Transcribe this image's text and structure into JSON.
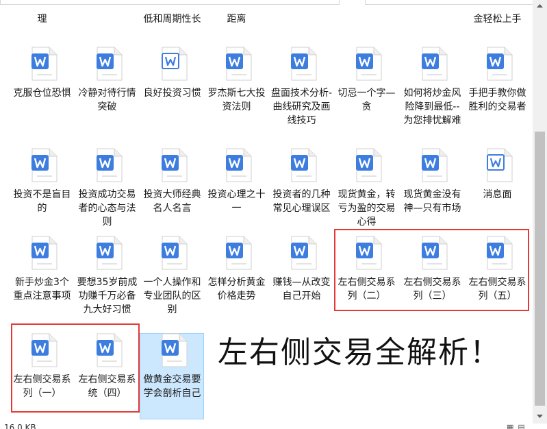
{
  "partial_top_labels": [
    "理",
    "低和周期性长",
    "距离",
    "金轻松上手"
  ],
  "files": [
    {
      "label": "克服仓位恐惧",
      "icon": "word-doc-icon"
    },
    {
      "label": "冷静对待行情突破",
      "icon": "word-doc-icon"
    },
    {
      "label": "良好投资习惯",
      "icon": "word-doc-outline-icon"
    },
    {
      "label": "罗杰斯七大投资法则",
      "icon": "word-doc-icon"
    },
    {
      "label": "盘面技术分析-曲线研究及画线技巧",
      "icon": "word-doc-icon"
    },
    {
      "label": "切忌一个字—贪",
      "icon": "word-doc-icon"
    },
    {
      "label": "如何将炒金风险降到最低--为您排忧解难",
      "icon": "word-doc-icon"
    },
    {
      "label": "手把手教你做胜利的交易者",
      "icon": "word-doc-icon"
    },
    {
      "label": "投资不是盲目的",
      "icon": "word-doc-icon"
    },
    {
      "label": "投资成功交易者的心态与法则",
      "icon": "word-doc-icon"
    },
    {
      "label": "投资大师经典名人名言",
      "icon": "word-doc-icon"
    },
    {
      "label": "投资心理之十一",
      "icon": "word-doc-icon"
    },
    {
      "label": "投资者的几种常见心理误区",
      "icon": "word-doc-icon"
    },
    {
      "label": "现货黄金，转亏为盈的交易心得",
      "icon": "word-doc-icon"
    },
    {
      "label": "现货黄金没有神—只有市场",
      "icon": "word-doc-icon"
    },
    {
      "label": "消息面",
      "icon": "word-doc-outline-icon"
    },
    {
      "label": "新手炒金3个重点注意事项",
      "icon": "word-doc-icon"
    },
    {
      "label": "要想35岁前成功赚千万必备九大好习惯",
      "icon": "word-doc-icon"
    },
    {
      "label": "一个人操作和专业团队的区别",
      "icon": "word-doc-icon"
    },
    {
      "label": "怎样分析黄金价格走势",
      "icon": "word-doc-icon"
    },
    {
      "label": "赚钱—从改变自己开始",
      "icon": "word-doc-icon"
    },
    {
      "label": "左右侧交易系列（二）",
      "icon": "word-doc-icon"
    },
    {
      "label": "左右侧交易系列（三）",
      "icon": "word-doc-icon"
    },
    {
      "label": "左右侧交易系列（五）",
      "icon": "word-doc-icon"
    },
    {
      "label": "左右侧交易系列（一）",
      "icon": "word-doc-icon"
    },
    {
      "label": "左右侧交易系统（四）",
      "icon": "word-doc-icon"
    },
    {
      "label": "做黄金交易要学会剖析自己",
      "icon": "word-doc-icon"
    }
  ],
  "overlay_title": "左右侧交易全解析！",
  "status": {
    "size_text": "16.0 KB"
  },
  "colors": {
    "accent": "#3d7de0",
    "highlight": "#e53935",
    "selection": "#cce8ff"
  }
}
